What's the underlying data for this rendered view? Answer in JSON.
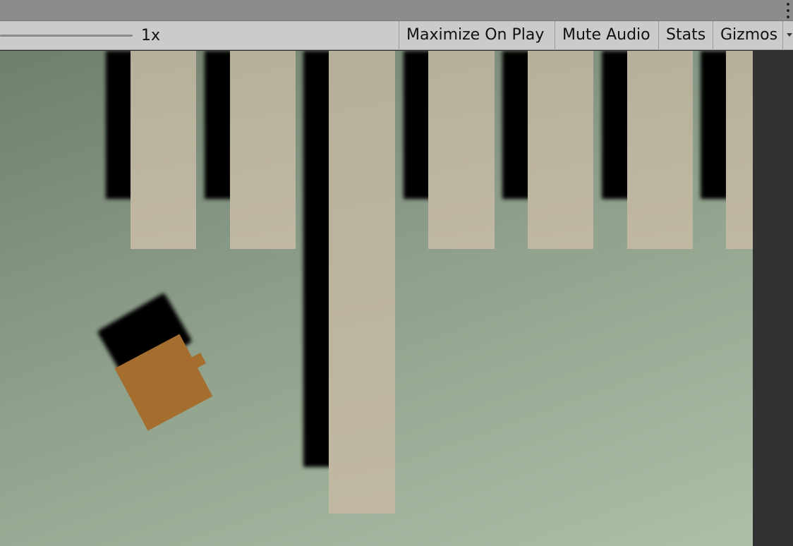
{
  "toolbar": {
    "scale_label": "1x",
    "maximize_label": "Maximize On Play",
    "mute_label": "Mute Audio",
    "stats_label": "Stats",
    "gizmos_label": "Gizmos"
  },
  "scene": {
    "pillar_color": "#bcb49e",
    "ground_color": "#8fa08c",
    "player_color": "#a56d2e",
    "pillar_count": 7
  }
}
